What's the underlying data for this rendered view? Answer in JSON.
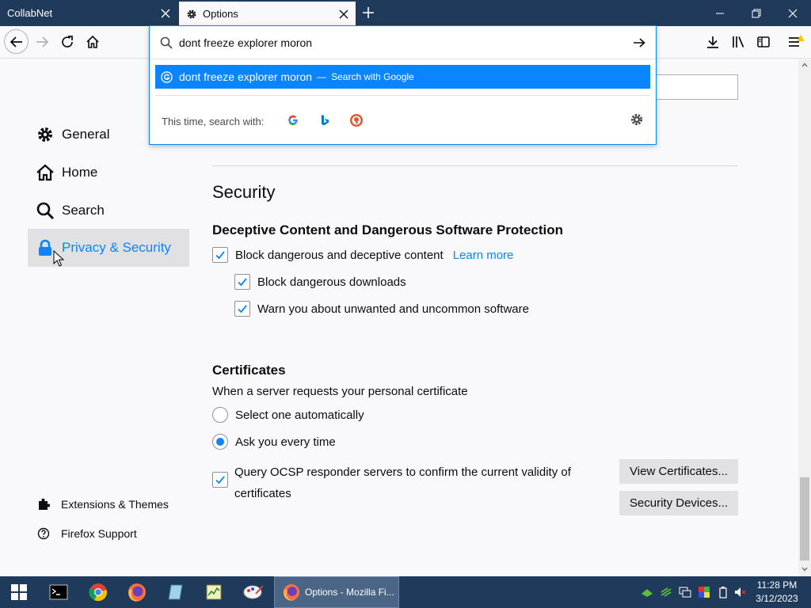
{
  "tabs": [
    {
      "label": "CollabNet",
      "active": false
    },
    {
      "label": "Options",
      "active": true
    }
  ],
  "urlbar": {
    "query": "dont freeze explorer moron",
    "suggestion_text": "dont freeze explorer moron",
    "suggestion_sep": "—",
    "suggestion_action": "Search with Google",
    "search_with_label": "This time, search with:"
  },
  "sidebar": {
    "categories": [
      {
        "label": "General",
        "icon": "gear-icon"
      },
      {
        "label": "Home",
        "icon": "home-icon"
      },
      {
        "label": "Search",
        "icon": "search-icon"
      },
      {
        "label": "Privacy & Security",
        "icon": "lock-icon",
        "selected": true
      }
    ],
    "footer": [
      {
        "label": "Extensions & Themes",
        "icon": "puzzle-icon"
      },
      {
        "label": "Firefox Support",
        "icon": "help-icon"
      }
    ]
  },
  "security": {
    "heading": "Security",
    "deceptive_heading": "Deceptive Content and Dangerous Software Protection",
    "block_deceptive": "Block dangerous and deceptive content",
    "learn_more": "Learn more",
    "block_downloads": "Block dangerous downloads",
    "warn_unwanted": "Warn you about unwanted and uncommon software"
  },
  "certificates": {
    "heading": "Certificates",
    "description": "When a server requests your personal certificate",
    "select_auto": "Select one automatically",
    "ask_every": "Ask you every time",
    "ocsp_line1": "Query OCSP responder servers to confirm the current validity of",
    "ocsp_line2": "certificates",
    "view_button": "View Certificates...",
    "devices_button": "Security Devices..."
  },
  "taskbar": {
    "active_window": "Options - Mozilla Fi...",
    "time": "11:28 PM",
    "date": "3/12/2023"
  },
  "colors": {
    "accent": "#0a84ff",
    "titlebar": "#1f3a5a"
  }
}
